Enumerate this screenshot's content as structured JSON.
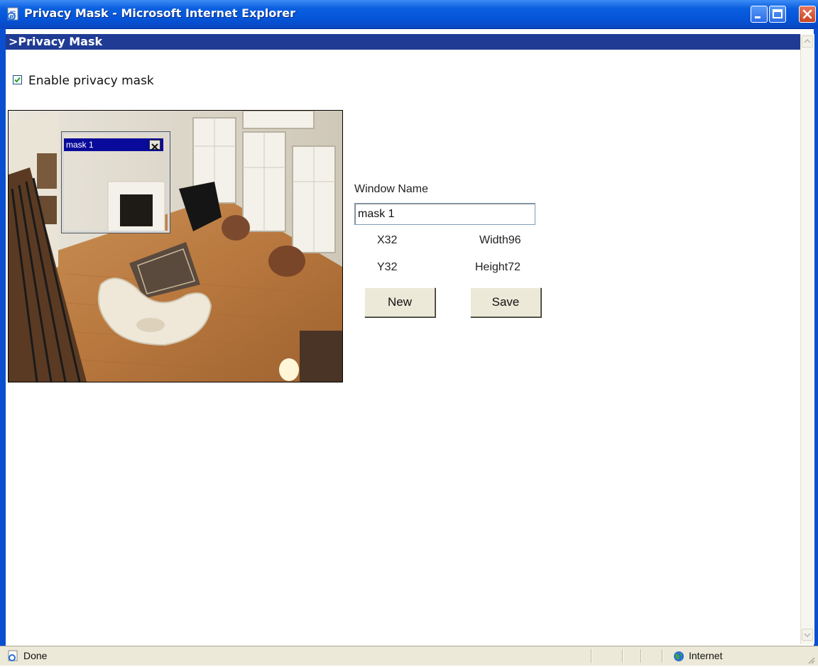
{
  "window": {
    "title": "Privacy Mask - Microsoft Internet Explorer"
  },
  "page": {
    "header": ">Privacy Mask",
    "enable_label": "Enable privacy mask",
    "enable_checked": true
  },
  "mask": {
    "title": "mask 1"
  },
  "form": {
    "window_name_label": "Window Name",
    "window_name_value": "mask 1",
    "x_label": "X32",
    "y_label": "Y32",
    "width_label": "Width96",
    "height_label": "Height72",
    "new_button": "New",
    "save_button": "Save"
  },
  "status": {
    "text": "Done",
    "zone": "Internet"
  },
  "colors": {
    "titlebar": "#0553d6",
    "header_bar": "#1f3b94",
    "mask_title": "#0a0a9a",
    "button_face": "#ece9d8"
  }
}
